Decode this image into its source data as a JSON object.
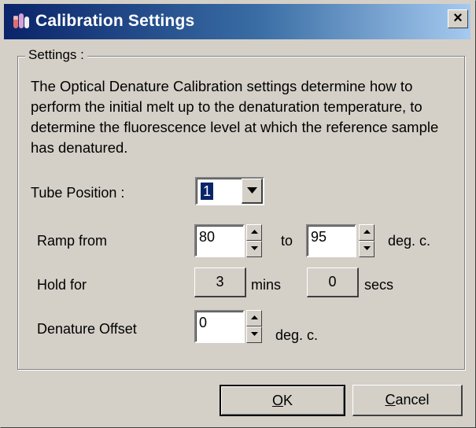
{
  "window": {
    "title": "Calibration Settings",
    "close_glyph": "×"
  },
  "group": {
    "legend": "Settings :",
    "description": "The Optical Denature Calibration settings determine how to perform the initial melt up to the denaturation temperature, to determine the fluorescence level at which the reference sample has denatured."
  },
  "tube_position": {
    "label": "Tube Position :",
    "value": "1"
  },
  "ramp": {
    "label": "Ramp from",
    "from_value": "80",
    "to_label": "to",
    "to_value": "95",
    "unit": "deg. c."
  },
  "hold": {
    "label": "Hold for",
    "mins_value": "3",
    "mins_label": "mins",
    "secs_value": "0",
    "secs_label": "secs"
  },
  "denature_offset": {
    "label": "Denature Offset",
    "value": "0",
    "unit": "deg. c."
  },
  "buttons": {
    "ok_mnemonic": "O",
    "ok_rest": "K",
    "cancel_mnemonic": "C",
    "cancel_rest": "ancel"
  },
  "icons": {
    "title_icon": "calibration-app-icon",
    "dropdown": "chevron-down-icon",
    "spin_up": "triangle-up-icon",
    "spin_down": "triangle-down-icon"
  },
  "colors": {
    "title_gradient_start": "#0a246a",
    "title_gradient_end": "#a6caf0",
    "face": "#d4d0c8",
    "selection": "#0a246a"
  }
}
